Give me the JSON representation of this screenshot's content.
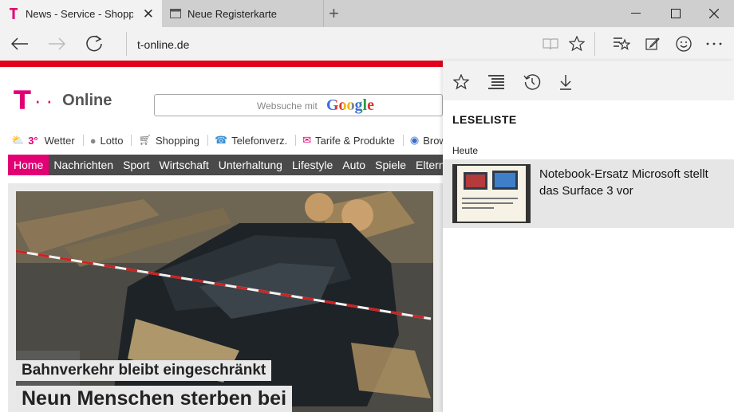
{
  "tabs": [
    {
      "label": "News - Service - Shopping",
      "icon": "telekom-favicon-icon",
      "active": true
    },
    {
      "label": "Neue Registerkarte",
      "icon": "page-icon",
      "active": false
    }
  ],
  "address": {
    "url": "t-online.de"
  },
  "site": {
    "logo_text": "Online",
    "search_placeholder": "Websuche mit",
    "search_brand": "Google",
    "weather_temp": "3°",
    "quick_links": [
      "Wetter",
      "Lotto",
      "Shopping",
      "Telefonverz.",
      "Tarife & Produkte",
      "Brow"
    ],
    "nav": [
      "Home",
      "Nachrichten",
      "Sport",
      "Wirtschaft",
      "Unterhaltung",
      "Lifestyle",
      "Auto",
      "Spiele",
      "Eltern"
    ],
    "headline_kicker": "Bahnverkehr bleibt eingeschränkt",
    "headline_main": "Neun Menschen sterben bei"
  },
  "hub": {
    "title": "LESELISTE",
    "group": "Heute",
    "items": [
      {
        "title": "Notebook-Ersatz Microsoft stellt das Surface 3 vor"
      }
    ]
  },
  "colors": {
    "brand": "#e20074",
    "red_bar": "#e2001a",
    "nav_bg": "#4a4a4a"
  }
}
